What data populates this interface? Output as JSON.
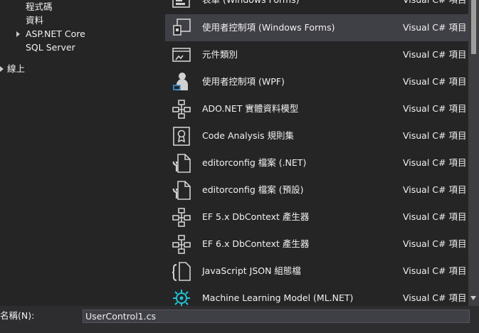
{
  "tree": {
    "items": [
      {
        "label": "程式碼"
      },
      {
        "label": "資料"
      },
      {
        "label": "ASP.NET Core"
      },
      {
        "label": "SQL Server"
      },
      {
        "label": "線上"
      }
    ]
  },
  "templates": [
    {
      "name": "表單 (Windows Forms)",
      "lang": "Visual C# 項目",
      "icon": "form-icon",
      "selected": false
    },
    {
      "name": "使用者控制項 (Windows Forms)",
      "lang": "Visual C# 項目",
      "icon": "user-control-icon",
      "selected": true
    },
    {
      "name": "元件類別",
      "lang": "Visual C# 項目",
      "icon": "component-class-icon",
      "selected": false
    },
    {
      "name": "使用者控制項 (WPF)",
      "lang": "Visual C# 項目",
      "icon": "wpf-user-control-icon",
      "selected": false
    },
    {
      "name": "ADO.NET 實體資料模型",
      "lang": "Visual C# 項目",
      "icon": "data-model-icon",
      "selected": false
    },
    {
      "name": "Code Analysis 規則集",
      "lang": "Visual C# 項目",
      "icon": "ruleset-icon",
      "selected": false
    },
    {
      "name": "editorconfig 檔案 (.NET)",
      "lang": "Visual C# 項目",
      "icon": "config-file-icon",
      "selected": false
    },
    {
      "name": "editorconfig 檔案 (預設)",
      "lang": "Visual C# 項目",
      "icon": "config-file-icon",
      "selected": false
    },
    {
      "name": "EF 5.x DbContext 產生器",
      "lang": "Visual C# 項目",
      "icon": "data-model-icon",
      "selected": false
    },
    {
      "name": "EF 6.x DbContext 產生器",
      "lang": "Visual C# 項目",
      "icon": "data-model-icon",
      "selected": false
    },
    {
      "name": "JavaScript JSON 組態檔",
      "lang": "Visual C# 項目",
      "icon": "json-file-icon",
      "selected": false
    },
    {
      "name": "Machine Learning Model (ML.NET)",
      "lang": "Visual C# 項目",
      "icon": "ml-model-icon",
      "selected": false
    }
  ],
  "name_field": {
    "label": "名稱(N):",
    "value": "UserControl1.cs"
  },
  "colors": {
    "background": "#252526",
    "selected_row": "#3f3f46",
    "ml_accent": "#1fc4d6"
  }
}
